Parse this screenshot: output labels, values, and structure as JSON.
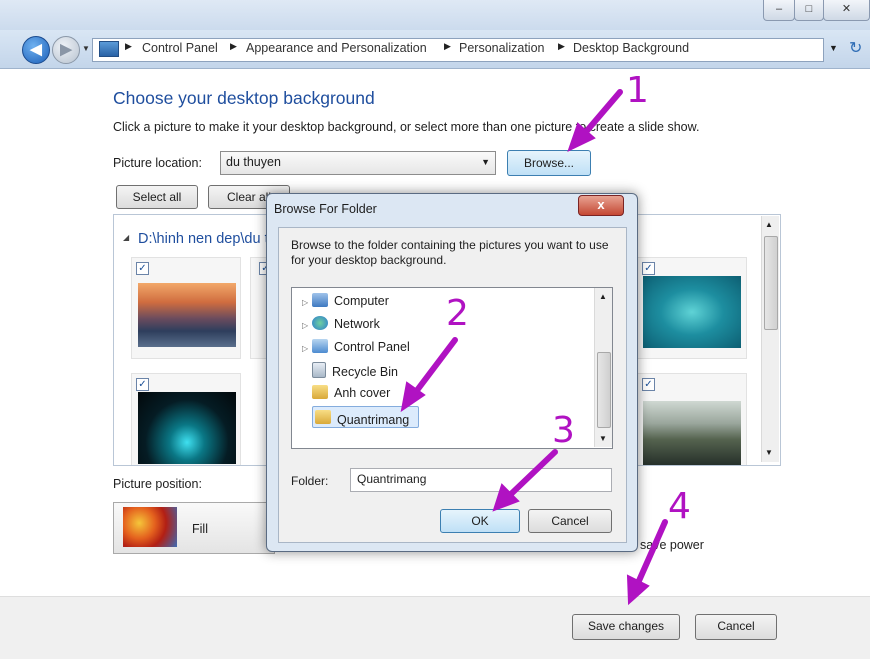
{
  "window": {
    "min_label": "–",
    "max_label": "□",
    "close_label": "✕"
  },
  "breadcrumb": [
    "Control Panel",
    "Appearance and Personalization",
    "Personalization",
    "Desktop Background"
  ],
  "page": {
    "heading": "Choose your desktop background",
    "instruction": "Click a picture to make it your desktop background, or select more than one picture to create a slide show.",
    "location_label": "Picture location:",
    "location_value": "du thuyen",
    "browse_label": "Browse...",
    "select_all_label": "Select all",
    "clear_all_label": "Clear all",
    "folder_group": "D:\\hinh nen dep\\du thuyen",
    "position_label": "Picture position:",
    "position_value": "Fill",
    "screensaver_text": "save power",
    "save_label": "Save changes",
    "cancel_label": "Cancel"
  },
  "dialog": {
    "title": "Browse For Folder",
    "close_label": "x",
    "description": "Browse to the folder containing the pictures you want to use for your desktop background.",
    "tree": [
      "Computer",
      "Network",
      "Control Panel",
      "Recycle Bin",
      "Anh cover",
      "Quantrimang"
    ],
    "folder_label": "Folder:",
    "folder_value": "Quantrimang",
    "ok_label": "OK",
    "cancel_label": "Cancel"
  },
  "annotations": [
    "1",
    "2",
    "3",
    "4"
  ],
  "colors": {
    "annotation": "#b012c2",
    "heading": "#1f4e9e",
    "accent": "#3c7fb1"
  }
}
